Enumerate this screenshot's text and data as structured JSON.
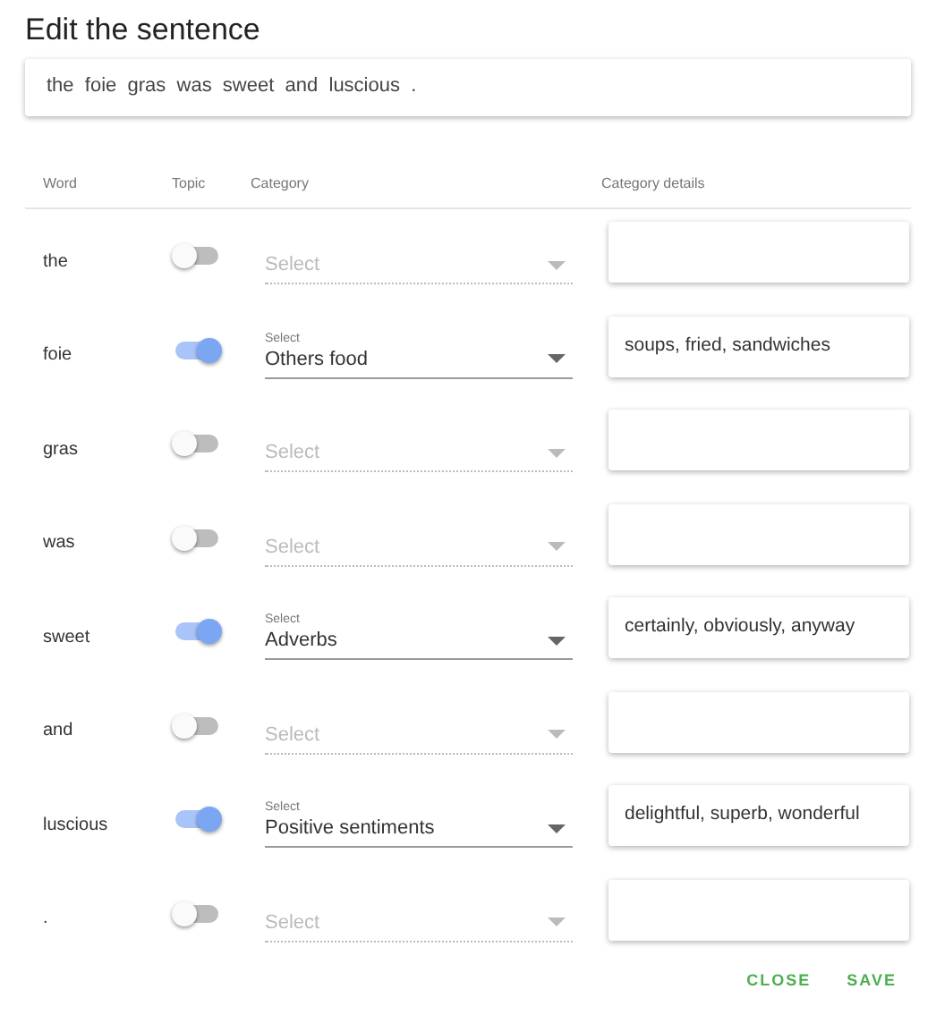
{
  "title": "Edit the sentence",
  "sentence": "the  foie  gras  was  sweet  and  luscious  .",
  "columns": [
    "Word",
    "Topic",
    "Category",
    "Category details"
  ],
  "rows": [
    {
      "word": "the",
      "topic": false,
      "category_label": "Select"
    },
    {
      "word": "foie",
      "topic": true,
      "category_label": "Select",
      "category": "Others food",
      "details": "soups, fried, sandwiches"
    },
    {
      "word": "gras",
      "topic": false,
      "category_label": "Select"
    },
    {
      "word": "was",
      "topic": false,
      "category_label": "Select"
    },
    {
      "word": "sweet",
      "topic": true,
      "category_label": "Select",
      "category": "Adverbs",
      "details": "certainly, obviously, anyway"
    },
    {
      "word": "and",
      "topic": false,
      "category_label": "Select"
    },
    {
      "word": "luscious",
      "topic": true,
      "category_label": "Select",
      "category": "Positive sentiments",
      "details": "delightful, superb, wonderful"
    },
    {
      "word": ".",
      "topic": false,
      "category_label": "Select"
    }
  ],
  "buttons": [
    "CLOSE",
    "SAVE"
  ]
}
